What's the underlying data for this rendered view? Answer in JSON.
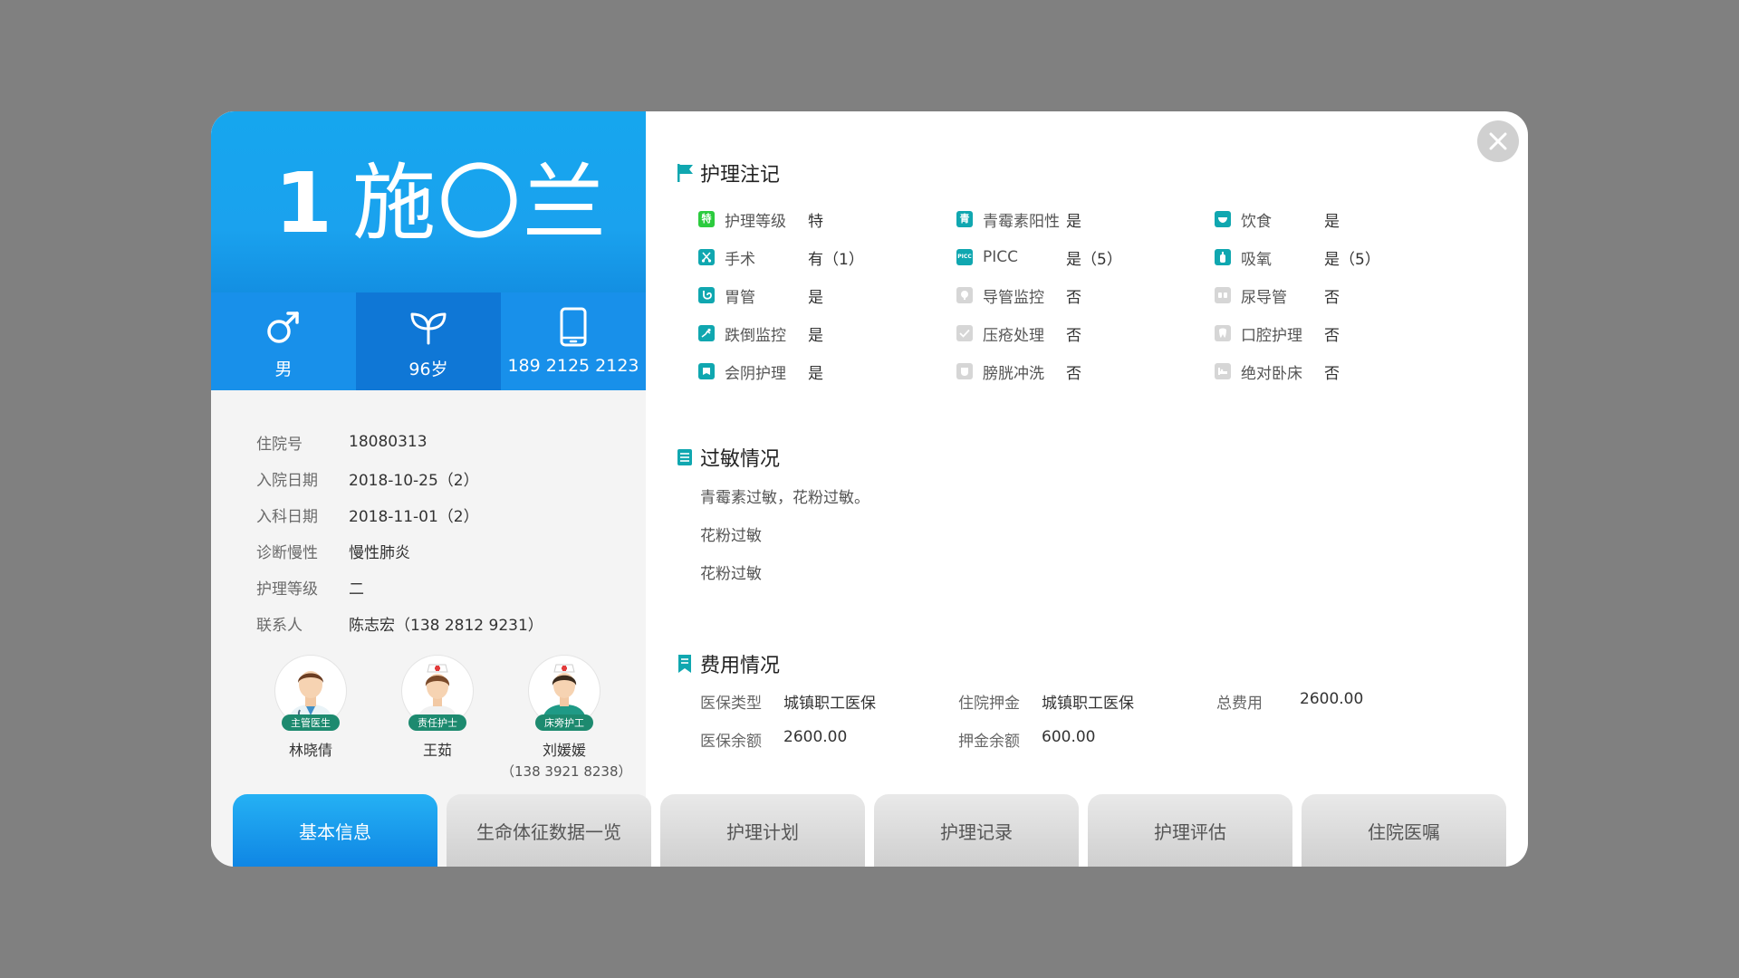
{
  "patient": {
    "bed_number": "1",
    "name": "施〇兰",
    "gender": "男",
    "age": "96岁",
    "phone": "189 2125 2123"
  },
  "info": [
    {
      "label": "住院号",
      "value": "18080313"
    },
    {
      "label": "入院日期",
      "value": "2018-10-25（2）"
    },
    {
      "label": "入科日期",
      "value": "2018-11-01（2）"
    },
    {
      "label": "诊断慢性",
      "value": "慢性肺炎"
    },
    {
      "label": "护理等级",
      "value": "二"
    },
    {
      "label": "联系人",
      "value": "陈志宏（138 2812 9231）"
    }
  ],
  "staff": [
    {
      "role": "主管医生",
      "name": "林晓倩",
      "phone": ""
    },
    {
      "role": "责任护士",
      "name": "王茹",
      "phone": ""
    },
    {
      "role": "床旁护工",
      "name": "刘媛媛",
      "phone": "（138 3921 8238）"
    }
  ],
  "sections": {
    "care_notes": "护理注记",
    "allergy": "过敏情况",
    "fees": "费用情况"
  },
  "care_notes": [
    {
      "label": "护理等级",
      "value": "特",
      "icon": "特",
      "state": "green"
    },
    {
      "label": "青霉素阳性",
      "value": "是",
      "icon": "青",
      "state": "on"
    },
    {
      "label": "饮食",
      "value": "是",
      "icon": "bowl-icon",
      "state": "on"
    },
    {
      "label": "手术",
      "value": "有（1）",
      "icon": "scissors-icon",
      "state": "on"
    },
    {
      "label": "PICC",
      "value": "是（5）",
      "icon": "PICC",
      "state": "on"
    },
    {
      "label": "吸氧",
      "value": "是（5）",
      "icon": "oxygen-icon",
      "state": "on"
    },
    {
      "label": "胃管",
      "value": "是",
      "icon": "stomach-tube-icon",
      "state": "on"
    },
    {
      "label": "导管监控",
      "value": "否",
      "icon": "catheter-monitor-icon",
      "state": "off"
    },
    {
      "label": "尿导管",
      "value": "否",
      "icon": "urinary-catheter-icon",
      "state": "off"
    },
    {
      "label": "跌倒监控",
      "value": "是",
      "icon": "fall-icon",
      "state": "on"
    },
    {
      "label": "压疮处理",
      "value": "否",
      "icon": "check-icon",
      "state": "off"
    },
    {
      "label": "口腔护理",
      "value": "否",
      "icon": "tooth-icon",
      "state": "off"
    },
    {
      "label": "会阴护理",
      "value": "是",
      "icon": "perineal-icon",
      "state": "on"
    },
    {
      "label": "膀胱冲洗",
      "value": "否",
      "icon": "bladder-icon",
      "state": "off"
    },
    {
      "label": "绝对卧床",
      "value": "否",
      "icon": "bed-icon",
      "state": "off"
    }
  ],
  "allergies": [
    "青霉素过敏，花粉过敏。",
    "花粉过敏",
    "花粉过敏"
  ],
  "fees": [
    {
      "label": "医保类型",
      "value": "城镇职工医保"
    },
    {
      "label": "住院押金",
      "value": "城镇职工医保"
    },
    {
      "label": "总费用",
      "value": "2600.00"
    },
    {
      "label": "医保余额",
      "value": "2600.00"
    },
    {
      "label": "押金余额",
      "value": "600.00"
    }
  ],
  "tabs": [
    "基本信息",
    "生命体征数据一览",
    "护理计划",
    "护理记录",
    "护理评估",
    "住院医嘱"
  ],
  "colors": {
    "accent": "#16a6ee",
    "accent_dark": "#0f77d6",
    "teal_icon": "#10a7b0",
    "badge_green": "#1d8a6f",
    "backdrop": "#808080"
  }
}
